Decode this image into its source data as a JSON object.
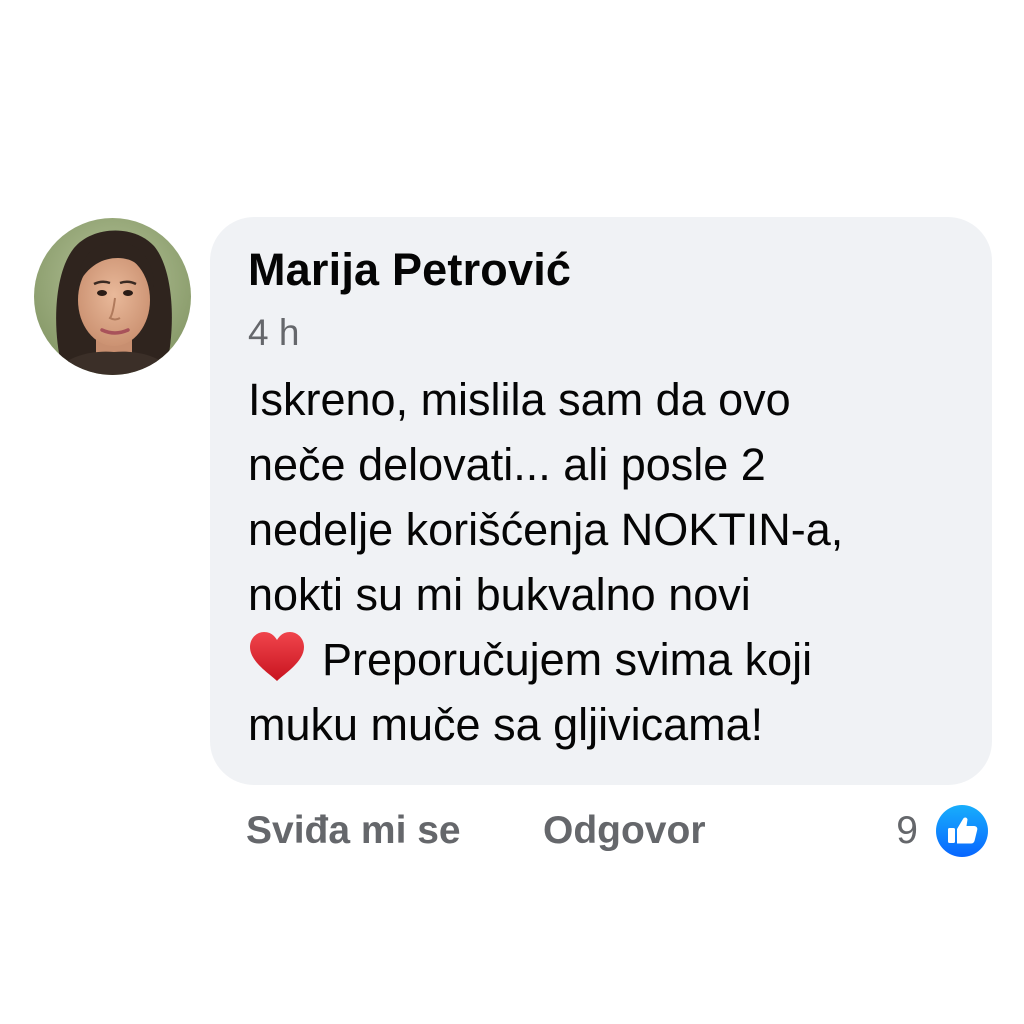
{
  "comment": {
    "author": "Marija Petrović",
    "timestamp": "4 h",
    "text_lines": [
      "Iskreno, mislila sam da ovo",
      "neče delovati... ali posle 2",
      "nedelje korišćenja NOKTIN-a,",
      "nokti su mi bukvalno novi"
    ],
    "text_line_with_emoji": {
      "emoji_icon": "red-heart-icon",
      "text": "Preporučujem svima koji"
    },
    "text_last_line": "muku muče sa gljivicama!"
  },
  "actions": {
    "like_label": "Sviđa mi se",
    "reply_label": "Odgovor"
  },
  "reactions": {
    "count": "9",
    "icon": "thumbs-up-icon"
  },
  "colors": {
    "bubble_bg": "#f0f2f5",
    "text": "#050505",
    "secondary_text": "#65676b",
    "like_blue": "#1877f2",
    "heart_red": "#e0252f"
  }
}
